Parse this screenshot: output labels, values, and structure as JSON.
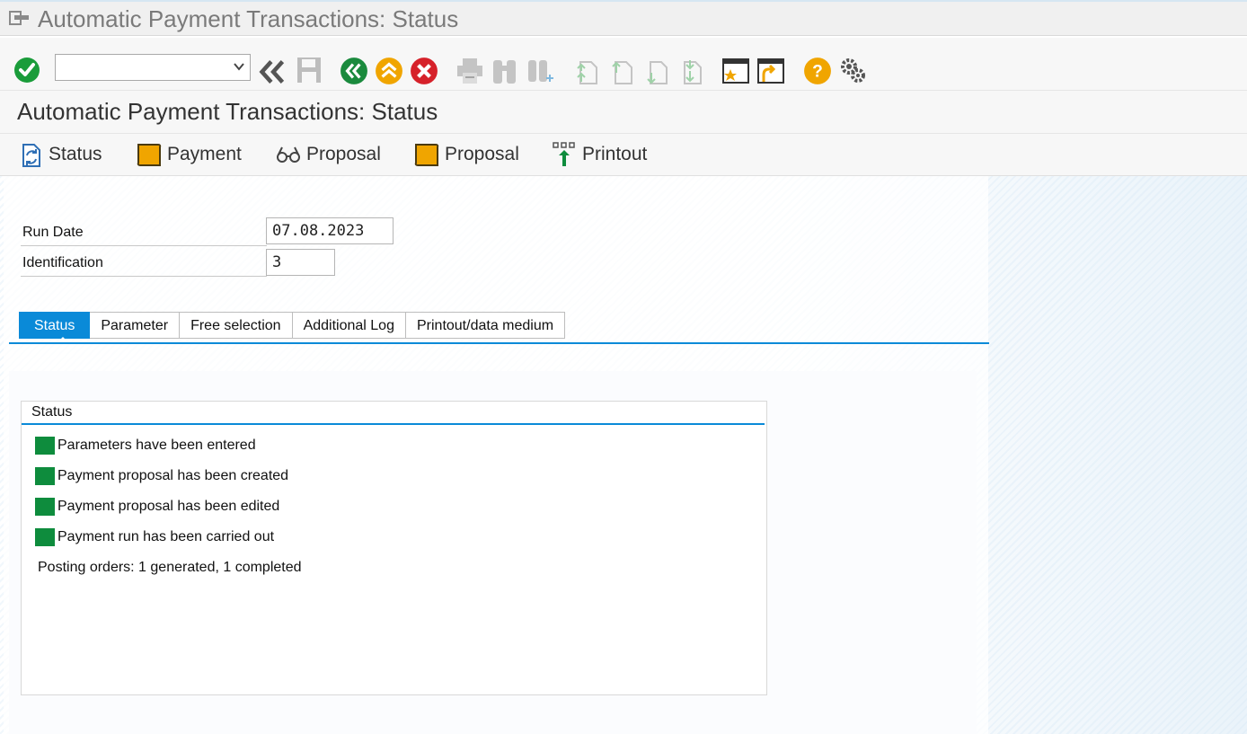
{
  "window": {
    "title": "Automatic Payment Transactions: Status"
  },
  "toolbar": {
    "command_field_value": "",
    "icons": [
      "enter-icon",
      "back-double-icon",
      "save-icon",
      "back-icon",
      "exit-icon",
      "cancel-icon",
      "print-icon",
      "find-icon",
      "find-next-icon",
      "first-page-icon",
      "previous-page-icon",
      "next-page-icon",
      "last-page-icon",
      "create-session-icon",
      "shortcut-icon",
      "help-icon",
      "customize-layout-icon"
    ]
  },
  "screen": {
    "title": "Automatic Payment Transactions: Status"
  },
  "app_toolbar": {
    "buttons": [
      {
        "label": "Status",
        "icon": "refresh-status-icon"
      },
      {
        "label": "Payment",
        "icon": "payment-icon"
      },
      {
        "label": "Proposal",
        "icon": "glasses-icon"
      },
      {
        "label": "Proposal",
        "icon": "proposal-icon"
      },
      {
        "label": "Printout",
        "icon": "printout-icon"
      }
    ]
  },
  "form": {
    "run_date_label": "Run Date",
    "run_date_value": "07.08.2023",
    "identification_label": "Identification",
    "identification_value": "3"
  },
  "tabs": [
    {
      "label": "Status",
      "active": true
    },
    {
      "label": "Parameter",
      "active": false
    },
    {
      "label": "Free selection",
      "active": false
    },
    {
      "label": "Additional Log",
      "active": false
    },
    {
      "label": "Printout/data medium",
      "active": false
    }
  ],
  "status_group": {
    "title": "Status",
    "items": [
      "Parameters have been entered",
      "Payment proposal has been created",
      "Payment proposal has been edited",
      "Payment run has been carried out"
    ],
    "posting_info": "Posting orders: 1 generated, 1 completed"
  },
  "colors": {
    "accent": "#0a8ad8",
    "status_ok": "#0e8c3d",
    "enter_green": "#1a9c3a",
    "nav_green": "#1a8a3d",
    "exit_orange": "#f0a500",
    "cancel_red": "#d6212a"
  }
}
